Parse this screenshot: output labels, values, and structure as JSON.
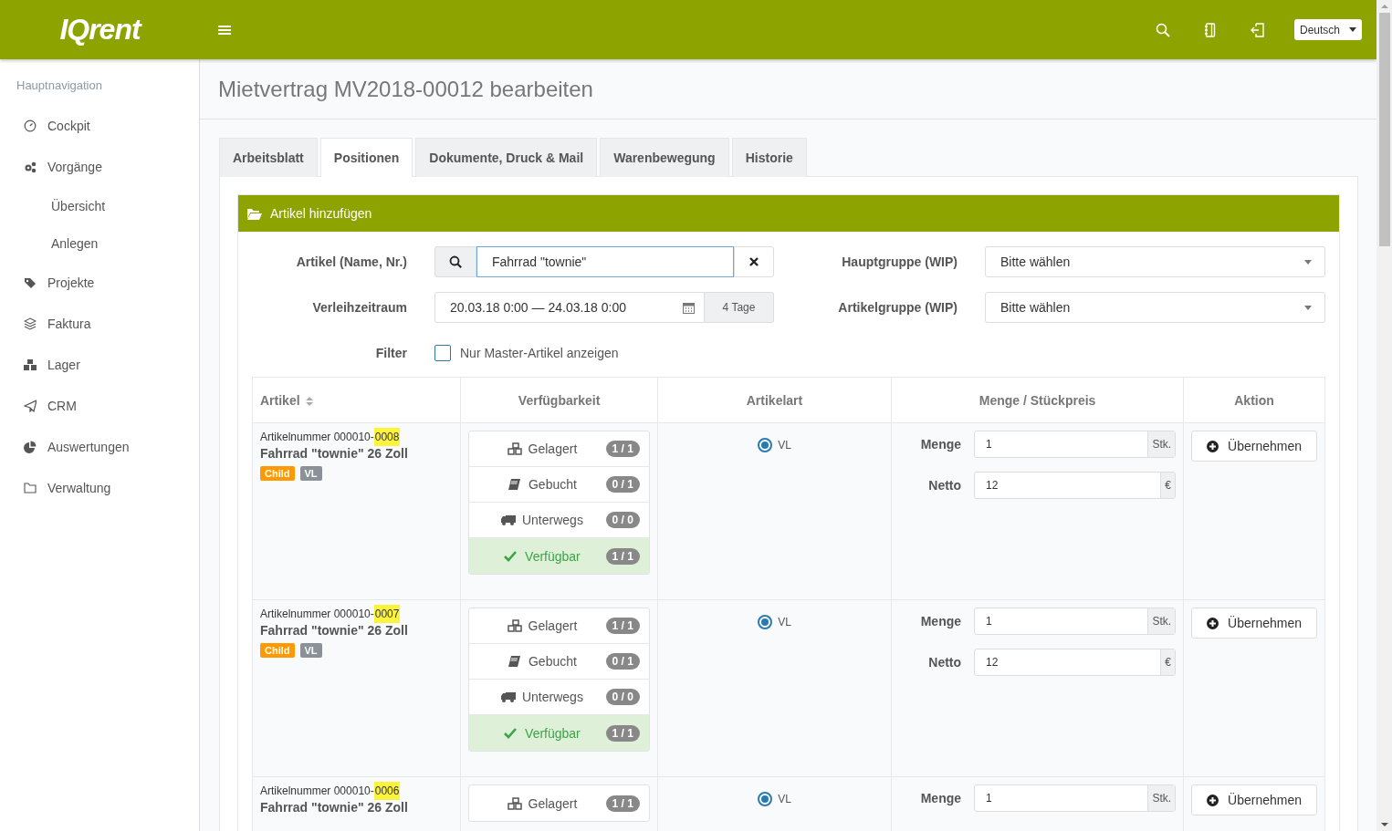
{
  "header": {
    "logo": "IQrent",
    "language": "Deutsch"
  },
  "sidebar": {
    "heading": "Hauptnavigation",
    "items": [
      {
        "label": "Cockpit"
      },
      {
        "label": "Vorgänge",
        "children": [
          {
            "label": "Übersicht"
          },
          {
            "label": "Anlegen"
          }
        ]
      },
      {
        "label": "Projekte"
      },
      {
        "label": "Faktura"
      },
      {
        "label": "Lager"
      },
      {
        "label": "CRM"
      },
      {
        "label": "Auswertungen"
      },
      {
        "label": "Verwaltung"
      }
    ]
  },
  "page": {
    "title": "Mietvertrag MV2018-00012 bearbeiten"
  },
  "tabs": [
    {
      "label": "Arbeitsblatt",
      "selected": false
    },
    {
      "label": "Positionen",
      "selected": true
    },
    {
      "label": "Dokumente, Druck & Mail",
      "selected": false
    },
    {
      "label": "Warenbewegung",
      "selected": false
    },
    {
      "label": "Historie",
      "selected": false
    }
  ],
  "card": {
    "title": "Artikel hinzufügen"
  },
  "form": {
    "article_label": "Artikel (Name, Nr.)",
    "article_value": "Fahrrad \"townie\"",
    "period_label": "Verleihzeitraum",
    "period_value": "20.03.18 0:00 — 24.03.18 0:00",
    "period_days": "4 Tage",
    "main_group_label": "Hauptgruppe (WIP)",
    "main_group_value": "Bitte wählen",
    "article_group_label": "Artikelgruppe (WIP)",
    "article_group_value": "Bitte wählen",
    "filter_label": "Filter",
    "filter_checkbox": {
      "label": "Nur Master-Artikel anzeigen",
      "checked": false
    }
  },
  "table": {
    "columns": [
      {
        "label": "Artikel",
        "sortable": true
      },
      {
        "label": "Verfügbarkeit",
        "sortable": false
      },
      {
        "label": "Artikelart",
        "sortable": false
      },
      {
        "label": "Menge / Stückpreis",
        "sortable": false
      },
      {
        "label": "Aktion",
        "sortable": false
      }
    ],
    "rows": [
      {
        "number_prefix": "Artikelnummer 000010-",
        "number_match": "0008",
        "name": "Fahrrad \"townie\" 26 Zoll",
        "badges": [
          {
            "label": "Child",
            "kind": "child"
          },
          {
            "label": "VL",
            "kind": "type"
          }
        ],
        "availability": [
          {
            "label": "Gelagert",
            "count": "1 / 1",
            "kind": "stored"
          },
          {
            "label": "Gebucht",
            "count": "0 / 1",
            "kind": "booked"
          },
          {
            "label": "Unterwegs",
            "count": "0 / 0",
            "kind": "transit"
          },
          {
            "label": "Verfügbar",
            "count": "1 / 1",
            "kind": "available"
          }
        ],
        "type_option": {
          "label": "VL",
          "selected": true
        },
        "quantity": {
          "label": "Menge",
          "value": "1",
          "unit": "Stk."
        },
        "price": {
          "label": "Netto",
          "value": "12",
          "unit": "€"
        },
        "action": "Übernehmen"
      },
      {
        "number_prefix": "Artikelnummer 000010-",
        "number_match": "0007",
        "name": "Fahrrad \"townie\" 26 Zoll",
        "badges": [
          {
            "label": "Child",
            "kind": "child"
          },
          {
            "label": "VL",
            "kind": "type"
          }
        ],
        "availability": [
          {
            "label": "Gelagert",
            "count": "1 / 1",
            "kind": "stored"
          },
          {
            "label": "Gebucht",
            "count": "0 / 1",
            "kind": "booked"
          },
          {
            "label": "Unterwegs",
            "count": "0 / 0",
            "kind": "transit"
          },
          {
            "label": "Verfügbar",
            "count": "1 / 1",
            "kind": "available"
          }
        ],
        "type_option": {
          "label": "VL",
          "selected": true
        },
        "quantity": {
          "label": "Menge",
          "value": "1",
          "unit": "Stk."
        },
        "price": {
          "label": "Netto",
          "value": "12",
          "unit": "€"
        },
        "action": "Übernehmen"
      },
      {
        "number_prefix": "Artikelnummer 000010-",
        "number_match": "0006",
        "name": "Fahrrad \"townie\" 26 Zoll",
        "availability": [
          {
            "label": "Gelagert",
            "count": "1 / 1",
            "kind": "stored"
          }
        ],
        "type_option": {
          "label": "VL",
          "selected": true
        },
        "quantity": {
          "label": "Menge",
          "value": "1",
          "unit": "Stk."
        },
        "action": "Übernehmen"
      }
    ]
  }
}
